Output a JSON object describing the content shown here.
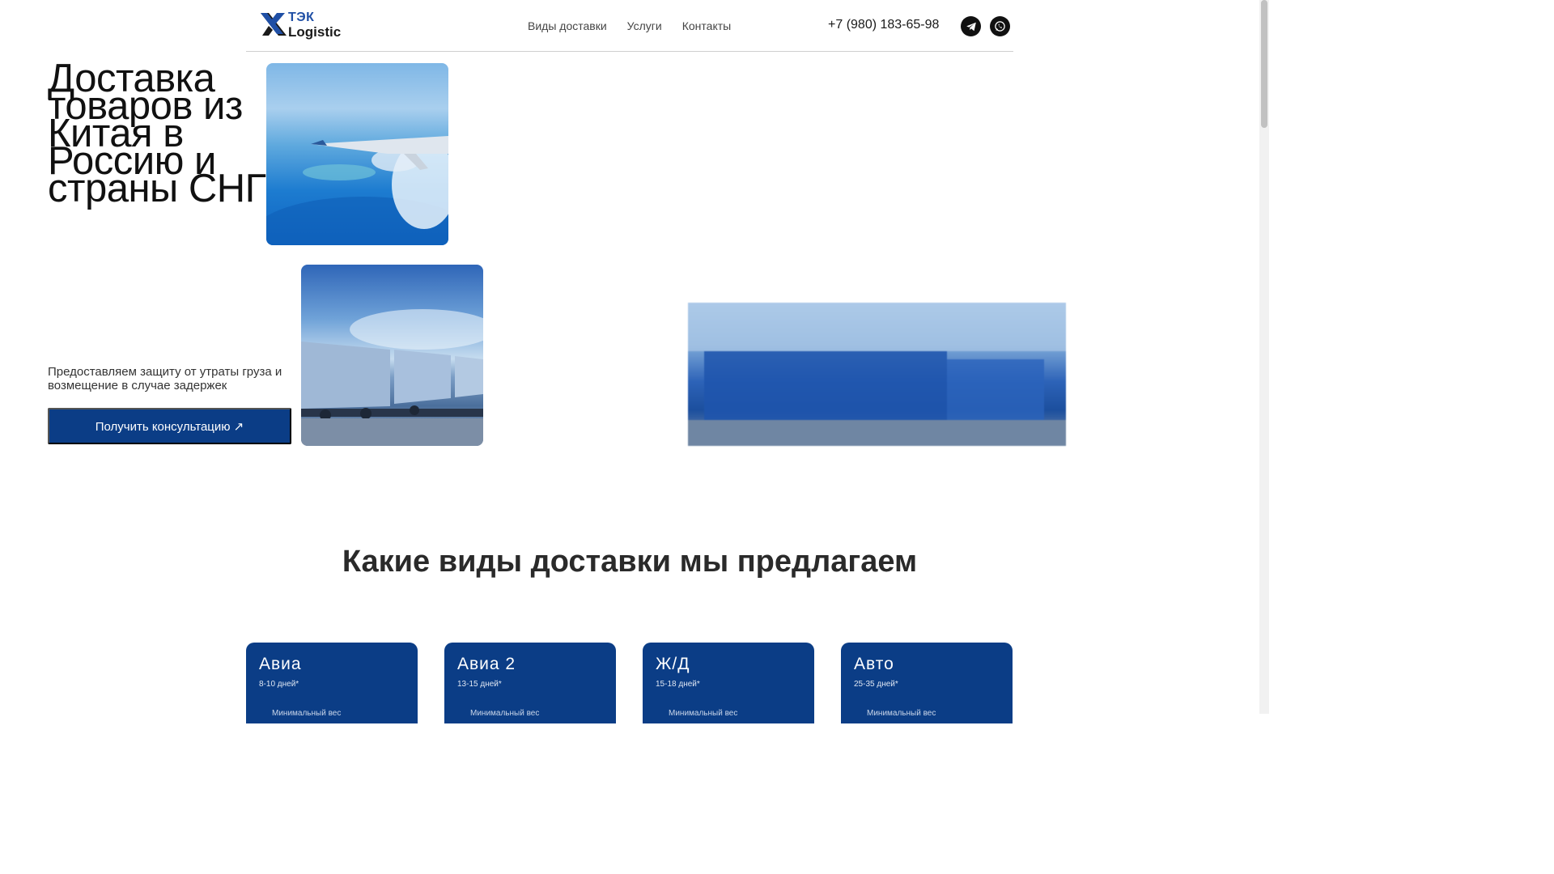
{
  "header": {
    "logo_top": "ТЭК",
    "logo_bottom": "Logistic",
    "nav": [
      {
        "label": "Виды доставки"
      },
      {
        "label": "Услуги"
      },
      {
        "label": "Контакты"
      }
    ],
    "phone": "+7 (980) 183-65-98",
    "social": [
      {
        "icon": "telegram-icon"
      },
      {
        "icon": "whatsapp-icon"
      }
    ]
  },
  "hero": {
    "title": "Доставка\nтоваров из\nКитая в\nРоссию и\nстраны СНГ",
    "subtitle": "Предоставляем защиту от утраты груза и возмещение в случае задержек",
    "cta_label": "Получить консультацию ↗"
  },
  "delivery": {
    "section_title": "Какие виды доставки мы предлагаем",
    "cards": [
      {
        "title": "Авиа",
        "days": "8-10 дней*",
        "note": "Минимальный вес"
      },
      {
        "title": "Авиа 2",
        "days": "13-15 дней*",
        "note": "Минимальный вес"
      },
      {
        "title": "Ж/Д",
        "days": "15-18 дней*",
        "note": "Минимальный вес"
      },
      {
        "title": "Авто",
        "days": "25-35 дней*",
        "note": "Минимальный вес"
      }
    ]
  },
  "colors": {
    "accent": "#0b3d86",
    "logo_blue": "#1f4fa5"
  }
}
